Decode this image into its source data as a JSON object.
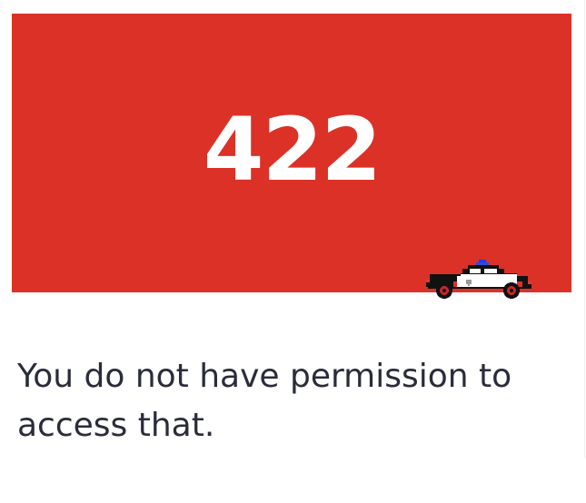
{
  "error": {
    "code": "422",
    "message": "You do not have permission to access that."
  },
  "illustration": {
    "icon": "police-car-icon"
  },
  "colors": {
    "hero_background": "#db3127",
    "code_text": "#ffffff",
    "message_text": "#2a2c3a",
    "siren": "#1b3df2"
  }
}
